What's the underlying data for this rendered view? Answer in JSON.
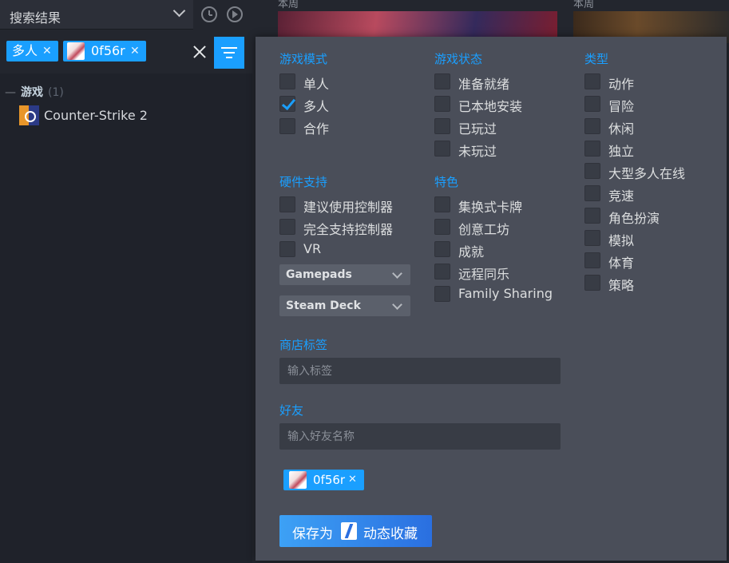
{
  "sidebar": {
    "collection_dropdown": "搜索结果",
    "filter_chips": [
      {
        "label": "多人"
      },
      {
        "label": "0f56r"
      }
    ],
    "group": {
      "name": "游戏",
      "count": "(1)"
    },
    "games": [
      {
        "name": "Counter-Strike 2"
      }
    ]
  },
  "background": {
    "label_left": "本周",
    "label_right": "本周"
  },
  "filters": {
    "game_mode": {
      "title": "游戏模式",
      "options": [
        {
          "label": "单人",
          "checked": false
        },
        {
          "label": "多人",
          "checked": true
        },
        {
          "label": "合作",
          "checked": false
        }
      ]
    },
    "game_status": {
      "title": "游戏状态",
      "options": [
        {
          "label": "准备就绪",
          "checked": false
        },
        {
          "label": "已本地安装",
          "checked": false
        },
        {
          "label": "已玩过",
          "checked": false
        },
        {
          "label": "未玩过",
          "checked": false
        }
      ]
    },
    "genre": {
      "title": "类型",
      "options": [
        {
          "label": "动作",
          "checked": false
        },
        {
          "label": "冒险",
          "checked": false
        },
        {
          "label": "休闲",
          "checked": false
        },
        {
          "label": "独立",
          "checked": false
        },
        {
          "label": "大型多人在线",
          "checked": false
        },
        {
          "label": "竞速",
          "checked": false
        },
        {
          "label": "角色扮演",
          "checked": false
        },
        {
          "label": "模拟",
          "checked": false
        },
        {
          "label": "体育",
          "checked": false
        },
        {
          "label": "策略",
          "checked": false
        }
      ]
    },
    "hardware": {
      "title": "硬件支持",
      "options": [
        {
          "label": "建议使用控制器",
          "checked": false
        },
        {
          "label": "完全支持控制器",
          "checked": false
        },
        {
          "label": "VR",
          "checked": false
        }
      ],
      "selects": [
        "Gamepads",
        "Steam Deck"
      ]
    },
    "features": {
      "title": "特色",
      "options": [
        {
          "label": "集换式卡牌",
          "checked": false
        },
        {
          "label": "创意工坊",
          "checked": false
        },
        {
          "label": "成就",
          "checked": false
        },
        {
          "label": "远程同乐",
          "checked": false
        },
        {
          "label": "Family Sharing",
          "checked": false
        }
      ]
    },
    "store_tags": {
      "title": "商店标签",
      "placeholder": "输入标签"
    },
    "friends": {
      "title": "好友",
      "placeholder": "输入好友名称",
      "selected": [
        {
          "name": "0f56r"
        }
      ]
    },
    "save_button": {
      "prefix": "保存为",
      "suffix": "动态收藏"
    }
  },
  "colors": {
    "accent": "#1a9fff",
    "panel": "#4a4e59",
    "checkbox": "#383c45"
  }
}
